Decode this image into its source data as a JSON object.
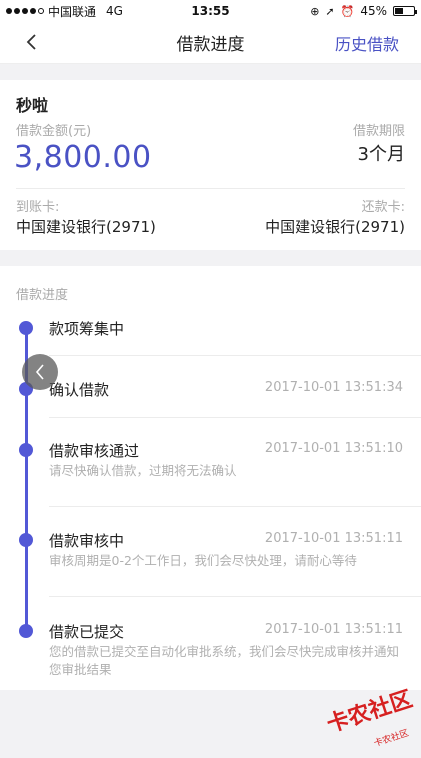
{
  "status_bar": {
    "carrier": "中国联通",
    "network": "4G",
    "time": "13:55",
    "battery": "45%",
    "battery_level": 0.45
  },
  "nav": {
    "title": "借款进度",
    "history_link": "历史借款"
  },
  "loan": {
    "product_name": "秒啦",
    "amount_label": "借款金额(元)",
    "amount_value": "3,800.00",
    "term_label": "借款期限",
    "term_value": "3个月",
    "in_card_label": "到账卡:",
    "in_card_value": "中国建设银行(2971)",
    "repay_card_label": "还款卡:",
    "repay_card_value": "中国建设银行(2971)"
  },
  "progress": {
    "title": "借款进度",
    "steps": [
      {
        "title": "款项筹集中",
        "time": "",
        "desc": ""
      },
      {
        "title": "确认借款",
        "time": "2017-10-01 13:51:34",
        "desc": ""
      },
      {
        "title": "借款审核通过",
        "time": "2017-10-01 13:51:10",
        "desc": "请尽快确认借款，过期将无法确认"
      },
      {
        "title": "借款审核中",
        "time": "2017-10-01 13:51:11",
        "desc": "审核周期是0-2个工作日，我们会尽快处理，请耐心等待"
      },
      {
        "title": "借款已提交",
        "time": "2017-10-01 13:51:11",
        "desc": "您的借款已提交至自动化审批系统，我们会尽快完成审核并通知您审批结果"
      }
    ]
  },
  "watermark": {
    "text": "卡农社区",
    "small_text": "卡农社区"
  },
  "colors": {
    "accent": "#4a52c4",
    "timeline": "#5258d6",
    "watermark": "#d62020"
  }
}
